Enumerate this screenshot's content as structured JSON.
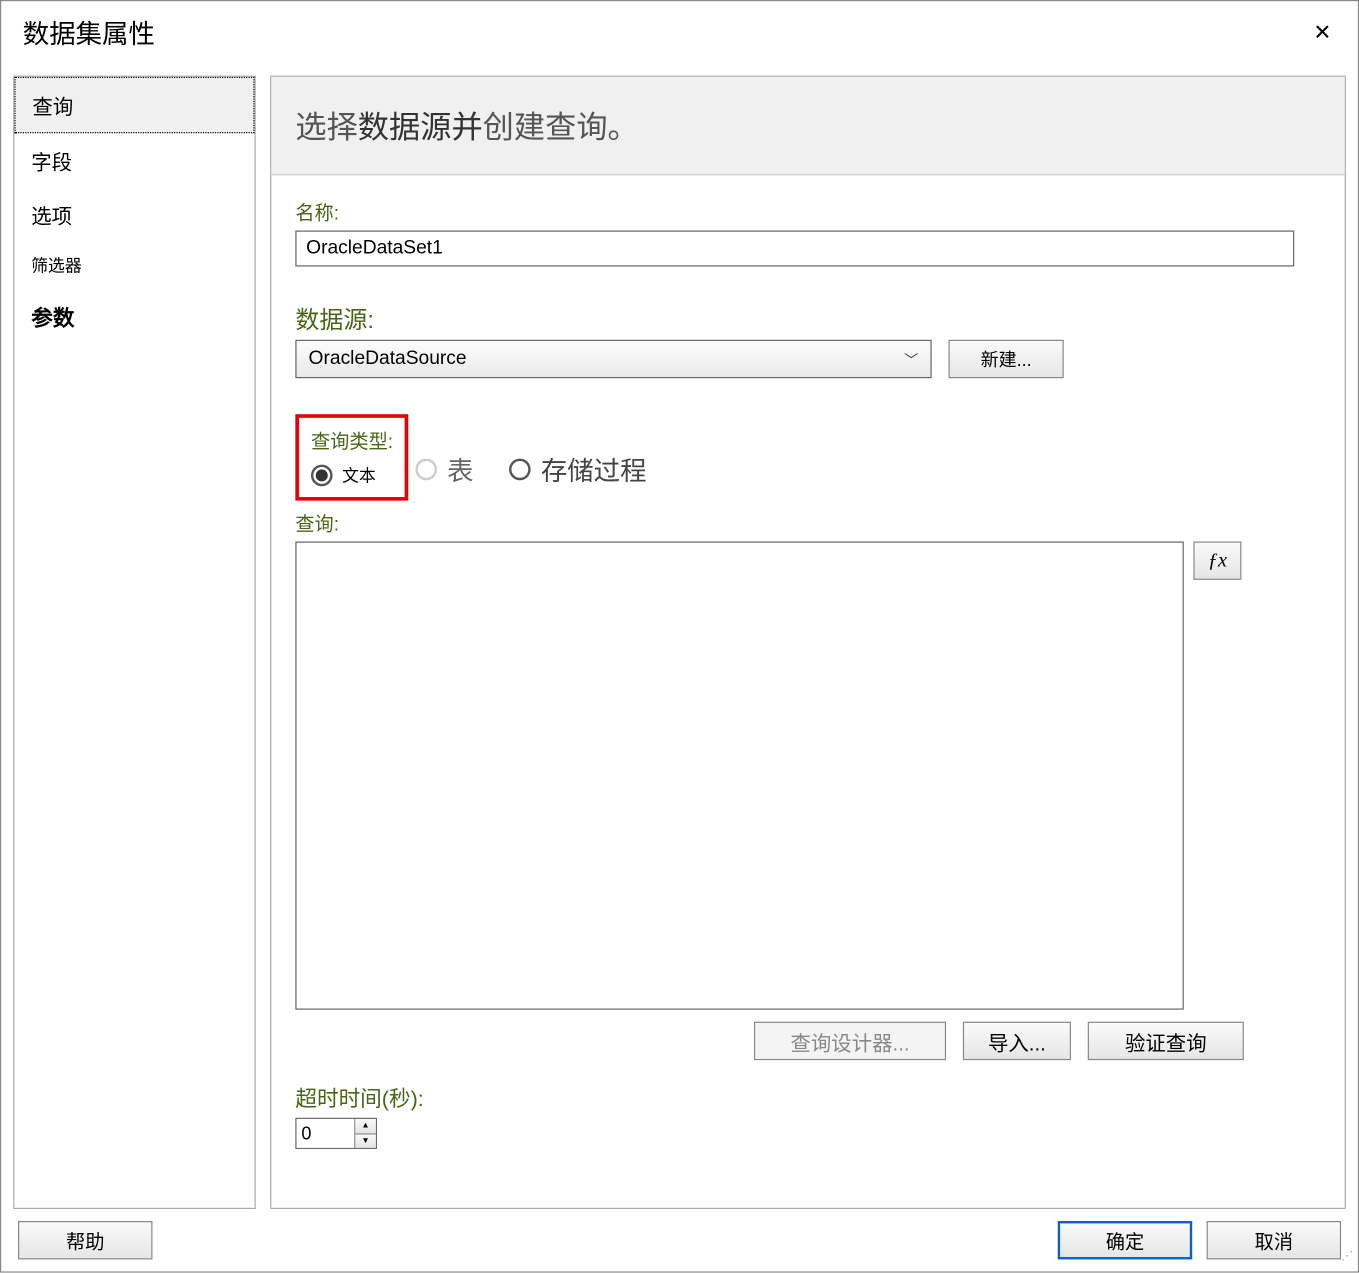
{
  "window": {
    "title": "数据集属性",
    "close_icon": "✕"
  },
  "sidebar": {
    "items": [
      {
        "label": "查询",
        "selected": true
      },
      {
        "label": "字段",
        "selected": false
      },
      {
        "label": "选项",
        "selected": false
      },
      {
        "label": "筛选器",
        "selected": false
      },
      {
        "label": "参数",
        "selected": false
      }
    ]
  },
  "main": {
    "heading_plain1": "选择",
    "heading_bold": "数据源并",
    "heading_plain2": "创建",
    "heading_tail": "查询。",
    "name_label": "名称:",
    "name_value": "OracleDataSet1",
    "ds_label": "数据源:",
    "ds_value": "OracleDataSource",
    "ds_new_btn": "新建...",
    "qtype_label": "查询类型:",
    "qtype_options": {
      "text": "文本",
      "table": "表",
      "sproc": "存储过程"
    },
    "qtype_selected": "text",
    "query_label": "查询:",
    "query_value": "",
    "fx_label": "ƒx",
    "buttons": {
      "designer": "查询设计器...",
      "import": "导入...",
      "validate": "验证查询"
    },
    "timeout_label": "超时时间(秒):",
    "timeout_value": "0"
  },
  "footer": {
    "help": "帮助",
    "ok": "确定",
    "cancel": "取消"
  }
}
